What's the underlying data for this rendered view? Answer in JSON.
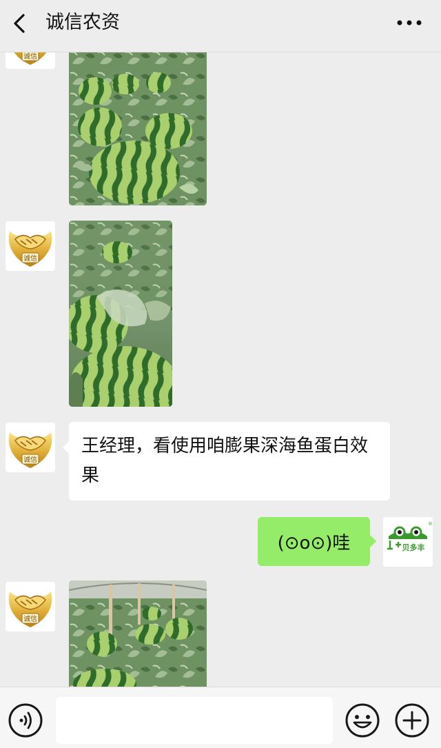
{
  "header": {
    "title": "诚信农资",
    "back_icon": "chevron-left-icon",
    "more_icon": "more-dots-icon"
  },
  "messages": [
    {
      "sender": "contact",
      "type": "image",
      "content": "watermelon field photo"
    },
    {
      "sender": "contact",
      "type": "image",
      "content": "watermelon field photo"
    },
    {
      "sender": "contact",
      "type": "text",
      "text": "王经理，看使用咱膨果深海鱼蛋白效果"
    },
    {
      "sender": "self",
      "type": "text",
      "text": "(⊙o⊙)哇"
    },
    {
      "sender": "contact",
      "type": "image",
      "content": "watermelon greenhouse photo"
    }
  ],
  "self_avatar": {
    "logo_text": "贝多丰",
    "registered_mark": "®",
    "brand_color": "#3a9a2e"
  },
  "contact_avatar": {
    "icon": "handshake-gold-icon",
    "seal_text": "诚信"
  },
  "bottom": {
    "voice_icon": "voice-icon",
    "input_value": "",
    "emoji_icon": "emoji-icon",
    "plus_icon": "plus-circle-icon"
  },
  "colors": {
    "background": "#ededed",
    "bubble_self": "#95ec69",
    "bubble_other": "#ffffff"
  }
}
